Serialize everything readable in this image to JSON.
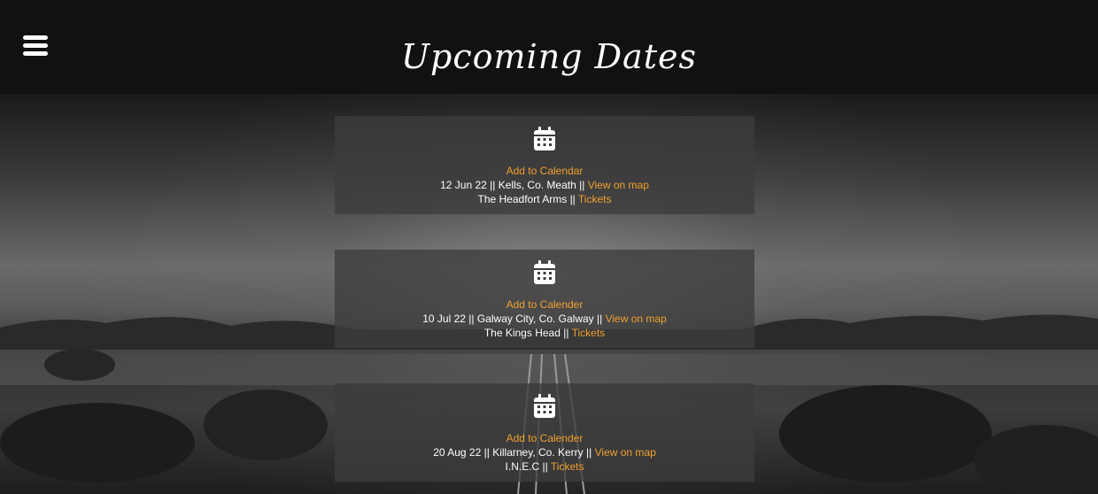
{
  "header": {
    "title": "Upcoming Dates",
    "menu_icon": "hamburger-menu-icon"
  },
  "colors": {
    "accent": "#f0a030",
    "header_bg": "#111111"
  },
  "events": [
    {
      "calendar_label": "Add to Calendar",
      "date": "12 Jun 22",
      "location": "Kells, Co. Meath",
      "map_label": "View on map",
      "venue": "The Headfort Arms",
      "tickets_label": "Tickets",
      "sep": "||"
    },
    {
      "calendar_label": "Add to Calender",
      "date": "10 Jul 22",
      "location": "Galway City, Co. Galway",
      "map_label": "View on map",
      "venue": "The Kings Head",
      "tickets_label": "Tickets",
      "sep": "||"
    },
    {
      "calendar_label": "Add to Calender",
      "date": "20 Aug 22",
      "location": "Killarney, Co. Kerry",
      "map_label": "View on map",
      "venue": "I.N.E.C",
      "tickets_label": "Tickets",
      "sep": "||"
    }
  ]
}
